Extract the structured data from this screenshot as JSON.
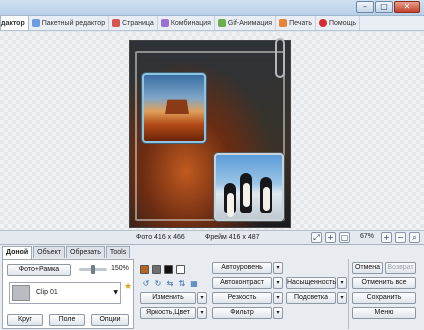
{
  "window": {
    "buttons": [
      "minimize",
      "maximize",
      "close"
    ]
  },
  "tabs": [
    {
      "label": "дактор",
      "icon": "editor-icon",
      "color": "#f2a93b"
    },
    {
      "label": "Пакетный редактор",
      "icon": "batch-editor-icon",
      "color": "#6d9be0"
    },
    {
      "label": "Страница",
      "icon": "page-icon",
      "color": "#d9534f"
    },
    {
      "label": "Комбинация",
      "icon": "combination-icon",
      "color": "#9b6fd4"
    },
    {
      "label": "Gif-Анимация",
      "icon": "gif-icon",
      "color": "#6ab04c"
    },
    {
      "label": "Печать",
      "icon": "print-icon",
      "color": "#e8833a"
    },
    {
      "label": "Помощь",
      "icon": "help-icon",
      "color": "#d62c2c"
    }
  ],
  "info": {
    "photo": "Фото 416 x 466",
    "frame": "Фрейм 416 x 487",
    "zoom": "67%"
  },
  "panel": {
    "tabs": [
      "Доной",
      "Объект",
      "Обрезать",
      "Tools"
    ],
    "photo_frame_button": "Фото+Рамка",
    "slider_percent": "150%",
    "slider_level": 0.5,
    "clip_label": "Clip 01",
    "circle": "Круг",
    "field": "Поле",
    "options": "Опции",
    "swatch_colors": [
      "#b5651d",
      "#6e6e6e",
      "#111111",
      "#ffffff"
    ],
    "change": "Изменить",
    "brightness": "Яркость,Цвет",
    "autolevel": "Автоуровень",
    "autocontrast": "Автоконтраст",
    "sharpness": "Резкость",
    "filter": "Фильтр",
    "saturation": "Насыщенность",
    "backlight": "Подсветка",
    "cancel": "Отмена",
    "redo": "Возврат",
    "cancel_all": "Отменить все",
    "save": "Сохранить",
    "menu": "Меню"
  }
}
